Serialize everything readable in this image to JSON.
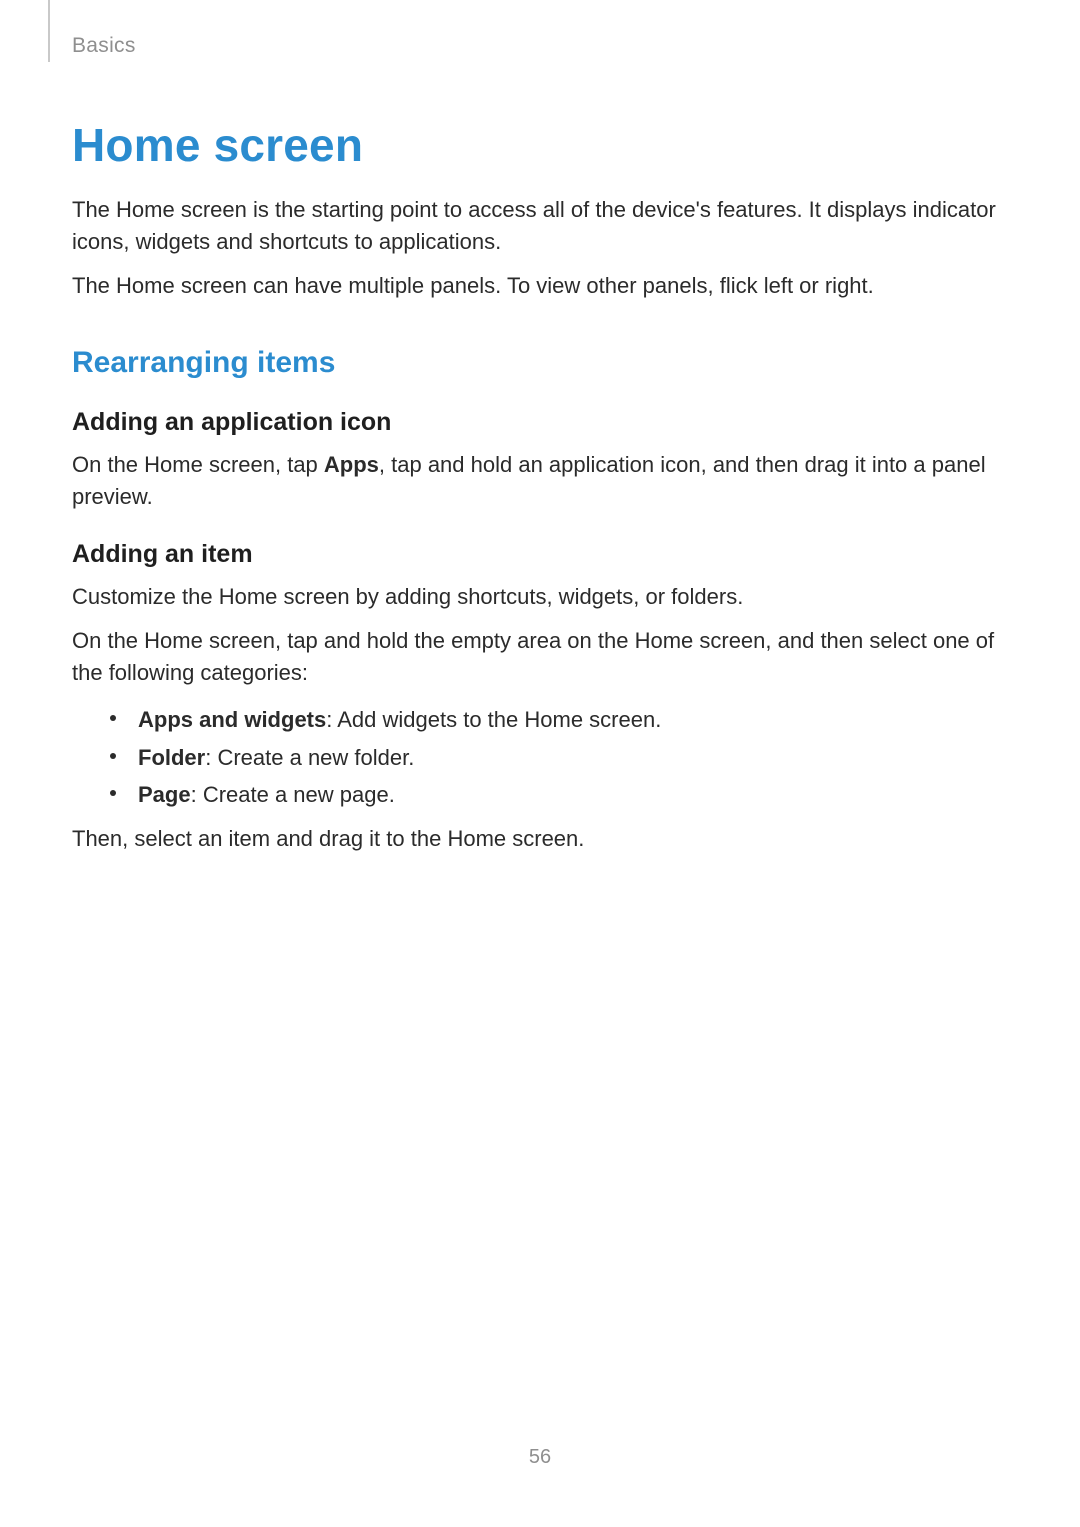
{
  "header": {
    "breadcrumb": "Basics"
  },
  "title": "Home screen",
  "intro": {
    "p1": "The Home screen is the starting point to access all of the device's features. It displays indicator icons, widgets and shortcuts to applications.",
    "p2": "The Home screen can have multiple panels. To view other panels, flick left or right."
  },
  "section": {
    "rearranging": {
      "heading": "Rearranging items",
      "addAppIcon": {
        "heading": "Adding an application icon",
        "p_before": "On the Home screen, tap ",
        "p_bold": "Apps",
        "p_after": ", tap and hold an application icon, and then drag it into a panel preview."
      },
      "addItem": {
        "heading": "Adding an item",
        "p1": "Customize the Home screen by adding shortcuts, widgets, or folders.",
        "p2": "On the Home screen, tap and hold the empty area on the Home screen, and then select one of the following categories:",
        "bullets": [
          {
            "lead": "Apps and widgets",
            "rest": ": Add widgets to the Home screen."
          },
          {
            "lead": "Folder",
            "rest": ": Create a new folder."
          },
          {
            "lead": "Page",
            "rest": ": Create a new page."
          }
        ],
        "p3": "Then, select an item and drag it to the Home screen."
      }
    }
  },
  "pageNumber": "56"
}
